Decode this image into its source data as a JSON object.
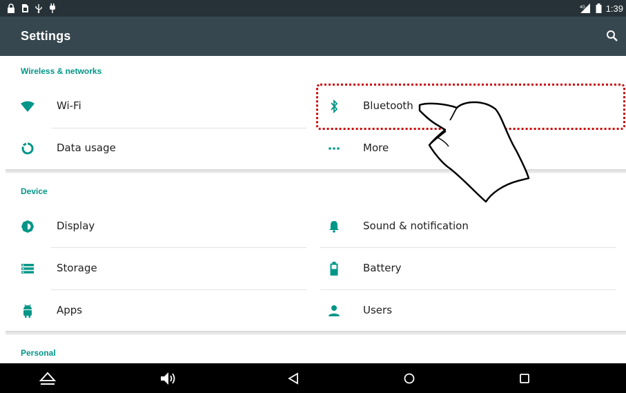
{
  "status_bar": {
    "time": "1:39"
  },
  "app_bar": {
    "title": "Settings",
    "search_icon": "search-icon"
  },
  "sections": [
    {
      "header": "Wireless & networks",
      "items": [
        {
          "label": "Wi-Fi",
          "icon": "wifi-icon"
        },
        {
          "label": "Bluetooth",
          "icon": "bluetooth-icon"
        },
        {
          "label": "Data usage",
          "icon": "data-usage-icon"
        },
        {
          "label": "More",
          "icon": "more-icon"
        }
      ]
    },
    {
      "header": "Device",
      "items": [
        {
          "label": "Display",
          "icon": "brightness-icon"
        },
        {
          "label": "Sound & notification",
          "icon": "bell-icon"
        },
        {
          "label": "Storage",
          "icon": "storage-icon"
        },
        {
          "label": "Battery",
          "icon": "battery-icon"
        },
        {
          "label": "Apps",
          "icon": "android-icon"
        },
        {
          "label": "Users",
          "icon": "person-icon"
        }
      ]
    },
    {
      "header": "Personal",
      "items": []
    }
  ],
  "nav_bar": {
    "buttons": [
      "collapse-icon",
      "volume-icon",
      "back-icon",
      "home-icon",
      "recents-icon"
    ]
  },
  "colors": {
    "status_bar": "#263238",
    "app_bar": "#37474f",
    "accent": "#009688",
    "highlight": "#cc0000"
  }
}
